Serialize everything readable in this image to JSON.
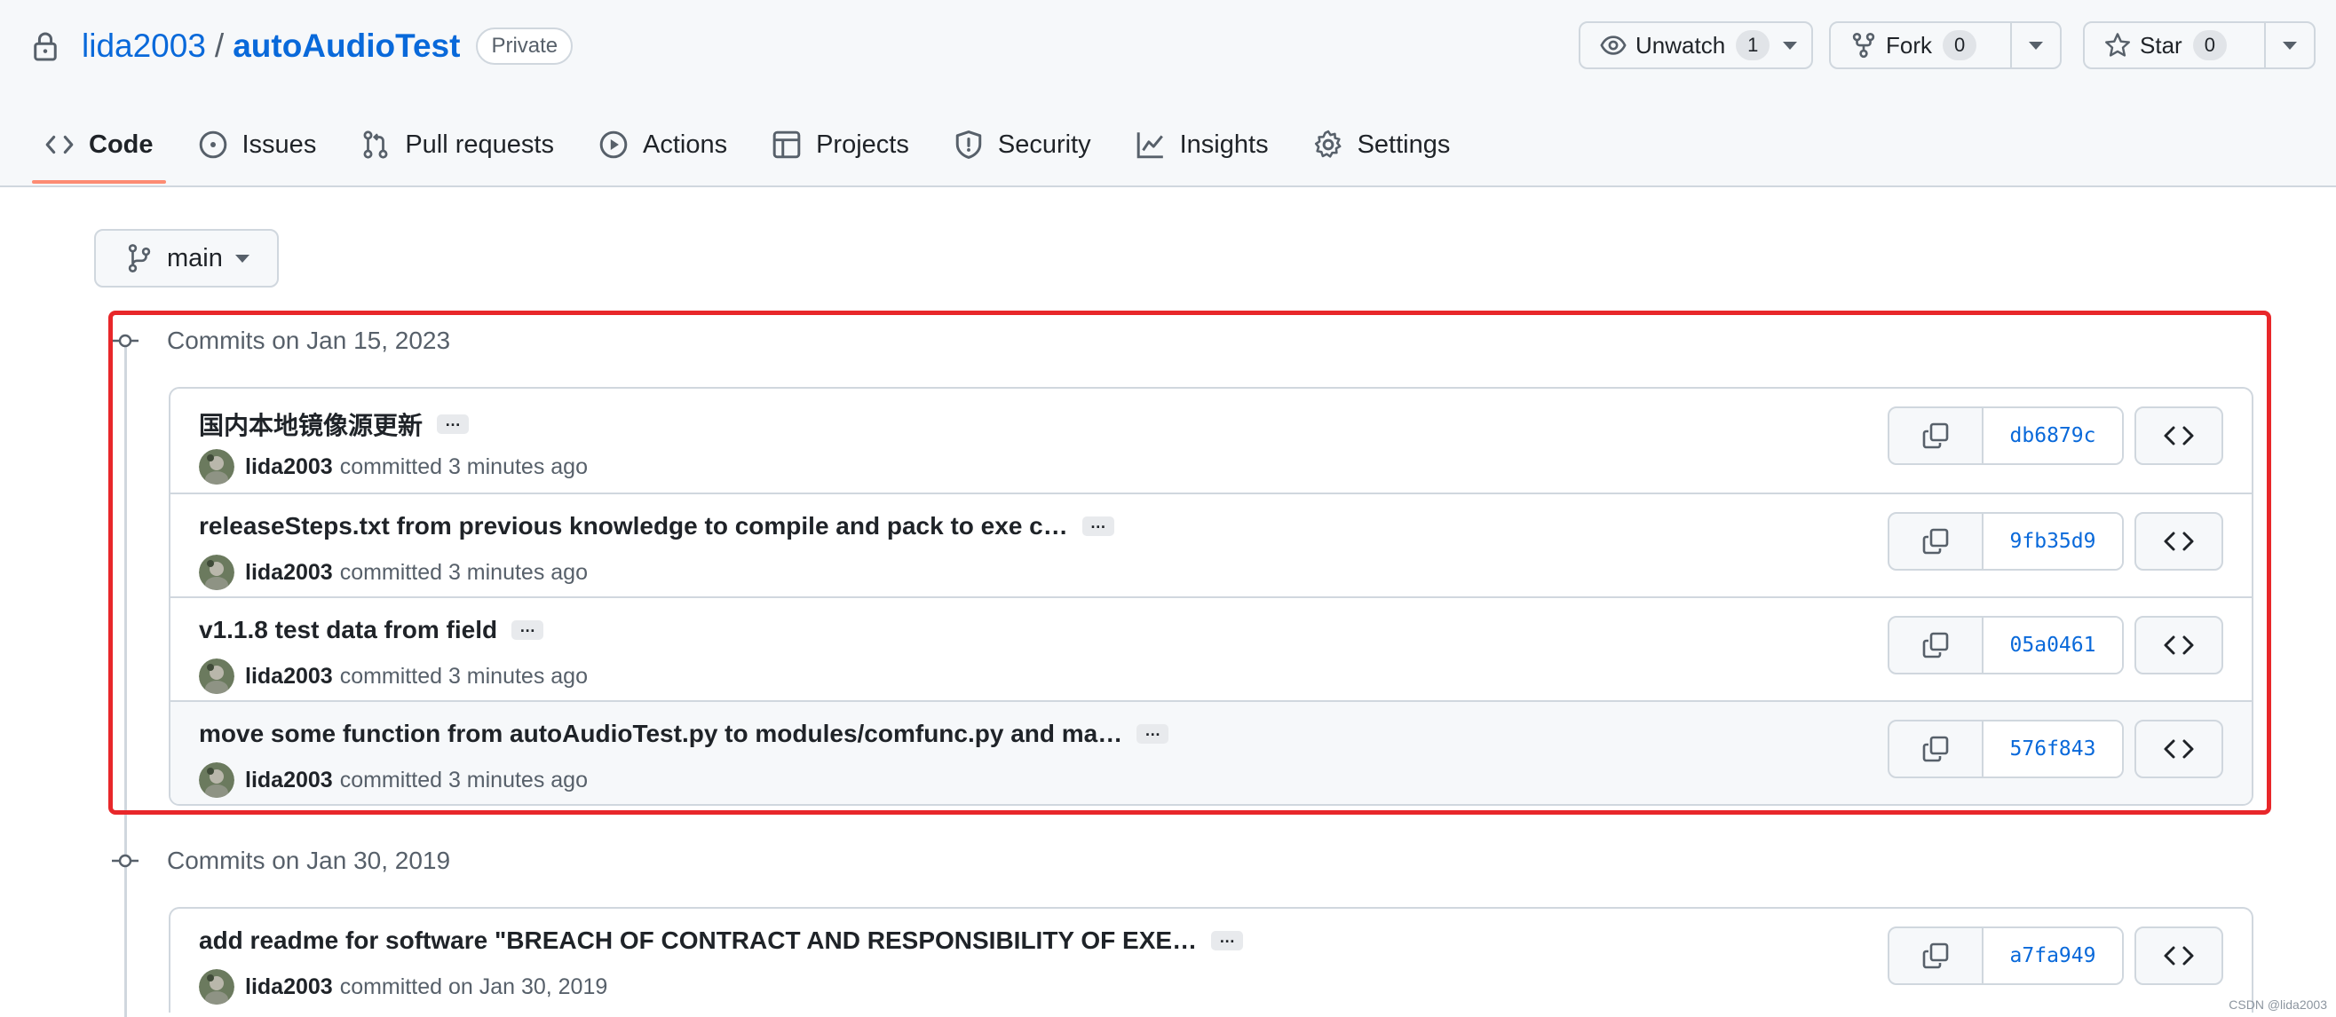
{
  "repo": {
    "owner": "lida2003",
    "name": "autoAudioTest",
    "visibility": "Private"
  },
  "actions": {
    "watch_label": "Unwatch",
    "watch_count": "1",
    "fork_label": "Fork",
    "fork_count": "0",
    "star_label": "Star",
    "star_count": "0"
  },
  "tabs": [
    {
      "label": "Code",
      "icon": "code-icon",
      "active": true
    },
    {
      "label": "Issues",
      "icon": "issue-icon"
    },
    {
      "label": "Pull requests",
      "icon": "pull-request-icon"
    },
    {
      "label": "Actions",
      "icon": "play-icon"
    },
    {
      "label": "Projects",
      "icon": "table-icon"
    },
    {
      "label": "Security",
      "icon": "shield-icon"
    },
    {
      "label": "Insights",
      "icon": "graph-icon"
    },
    {
      "label": "Settings",
      "icon": "gear-icon"
    }
  ],
  "branch": "main",
  "groups": [
    {
      "heading": "Commits on Jan 15, 2023",
      "commits": [
        {
          "message": "国内本地镜像源更新",
          "author": "lida2003",
          "when": "committed 3 minutes ago",
          "sha": "db6879c"
        },
        {
          "message": "releaseSteps.txt from previous knowledge to compile and pack to exe c…",
          "author": "lida2003",
          "when": "committed 3 minutes ago",
          "sha": "9fb35d9"
        },
        {
          "message": "v1.1.8 test data from field",
          "author": "lida2003",
          "when": "committed 3 minutes ago",
          "sha": "05a0461"
        },
        {
          "message": "move some function from autoAudioTest.py to modules/comfunc.py and ma…",
          "author": "lida2003",
          "when": "committed 3 minutes ago",
          "sha": "576f843"
        }
      ]
    },
    {
      "heading": "Commits on Jan 30, 2019",
      "commits": [
        {
          "message": "add readme for software \"BREACH OF CONTRACT AND RESPONSIBILITY OF EXE…",
          "author": "lida2003",
          "when": "committed on Jan 30, 2019",
          "sha": "a7fa949"
        }
      ]
    }
  ],
  "ellipsis_label": "…",
  "watermark": "CSDN @lida2003",
  "colors": {
    "link": "#0969da",
    "border": "#d0d7de",
    "tab_underline": "#fd8c73",
    "annotation_box": "#e8272a"
  }
}
